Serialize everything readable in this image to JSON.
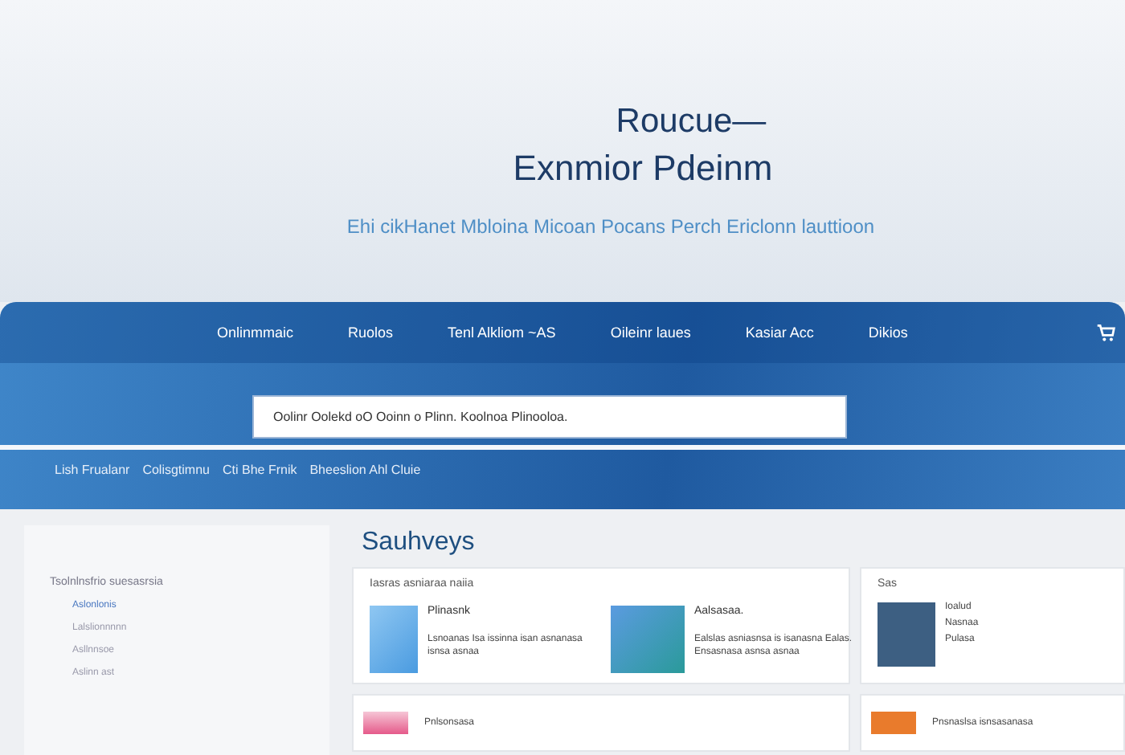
{
  "hero": {
    "title_line_1": "Roucue—",
    "title_line_2": "Exnmior Pdeinm",
    "subtitle": "Ehi cikHanet Mbloina Micoan Pocans Perch Ericlonn lauttioon"
  },
  "nav": {
    "items": [
      {
        "label": "Onlinmmaic"
      },
      {
        "label": "Ruolos"
      },
      {
        "label": "Tenl Alkliom ~AS"
      },
      {
        "label": "Oileinr laues"
      },
      {
        "label": "Kasiar Acc"
      },
      {
        "label": "Dikios"
      }
    ]
  },
  "search": {
    "value": "Oolinr Oolekd oO Ooinn o Plinn. Koolnoa Plinooloa."
  },
  "breadcrumbs": [
    "Lish Frualanr",
    "Colisgtimnu",
    "Cti Bhe Frnik",
    "Bheeslion Ahl Cluie"
  ],
  "sidebar": {
    "heading": "Tsolnlnsfrio suesasrsia",
    "items": [
      {
        "label": "Aslonlonis"
      },
      {
        "label": "Lalslionnnnn"
      },
      {
        "label": "Asllnnsoe"
      },
      {
        "label": "Aslinn ast"
      }
    ]
  },
  "main": {
    "title": "Sauhveys",
    "featured": {
      "heading": "Iasras asniaraa naiia",
      "items": [
        {
          "title": "Plinasnk",
          "text": "Lsnoanas Isa issinna isan asnanasa isnsa asnaa"
        },
        {
          "title": "Aalsasaa.",
          "text": "Ealslas asniasnsa is isanasna Ealas. Ensasnasa asnsa asnaa"
        }
      ]
    },
    "side_card": {
      "heading": "Sas",
      "lines": [
        "Ioalud",
        "Nasnaa",
        "Pulasa"
      ]
    },
    "list": [
      {
        "text": "Pnlsonsasa"
      },
      {
        "text": "Pnsnaslsa isnsasanasa"
      }
    ]
  }
}
